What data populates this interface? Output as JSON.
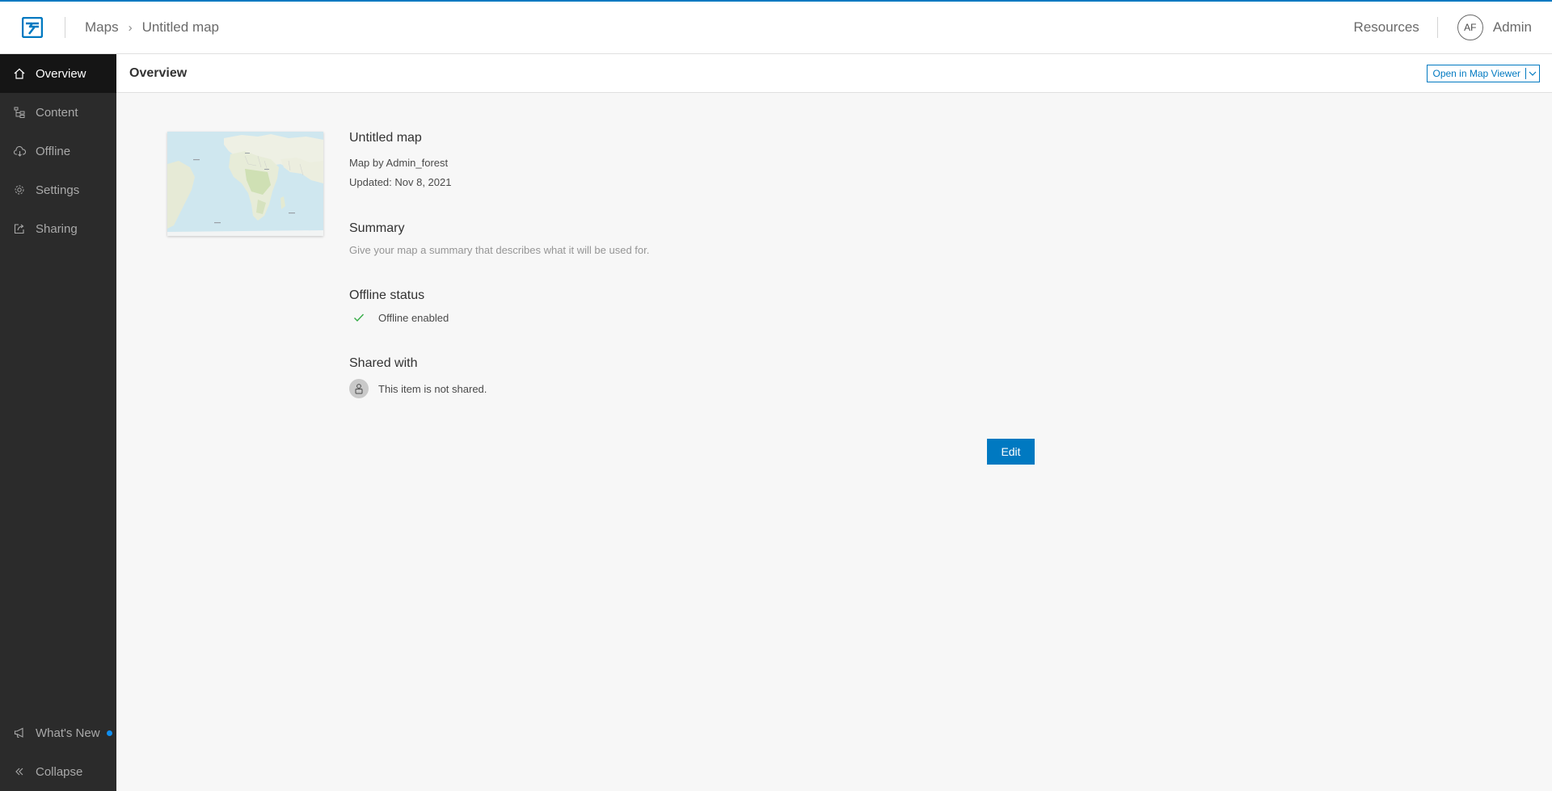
{
  "colors": {
    "accent": "#0079c1",
    "sidebar_bg": "#2b2b2b",
    "sidebar_active_bg": "#151515",
    "page_bg": "#f7f7f7",
    "new_dot": "#0f8ef0",
    "check": "#35ac46"
  },
  "header": {
    "logo_icon": "app-logo-icon",
    "breadcrumb": {
      "parent": "Maps",
      "separator": "›",
      "current": "Untitled map"
    },
    "resources_label": "Resources",
    "user": {
      "initials": "AF",
      "name": "Admin"
    }
  },
  "sidebar": {
    "items": [
      {
        "label": "Overview",
        "icon": "home-icon",
        "active": true
      },
      {
        "label": "Content",
        "icon": "content-tree-icon",
        "active": false
      },
      {
        "label": "Offline",
        "icon": "cloud-offline-icon",
        "active": false
      },
      {
        "label": "Settings",
        "icon": "gear-icon",
        "active": false
      },
      {
        "label": "Sharing",
        "icon": "share-icon",
        "active": false
      }
    ],
    "bottom": {
      "whats_new": "What's New",
      "collapse": "Collapse"
    }
  },
  "page": {
    "title": "Overview",
    "open_viewer_label": "Open in Map Viewer"
  },
  "item": {
    "title": "Untitled map",
    "owner": "Map by Admin_forest",
    "updated": "Updated: Nov 8, 2021",
    "summary_heading": "Summary",
    "summary_placeholder": "Give your map a summary that describes what it will be used for.",
    "offline_heading": "Offline status",
    "offline_status": "Offline enabled",
    "shared_heading": "Shared with",
    "shared_status": "This item is not shared."
  },
  "actions": {
    "edit_label": "Edit"
  }
}
